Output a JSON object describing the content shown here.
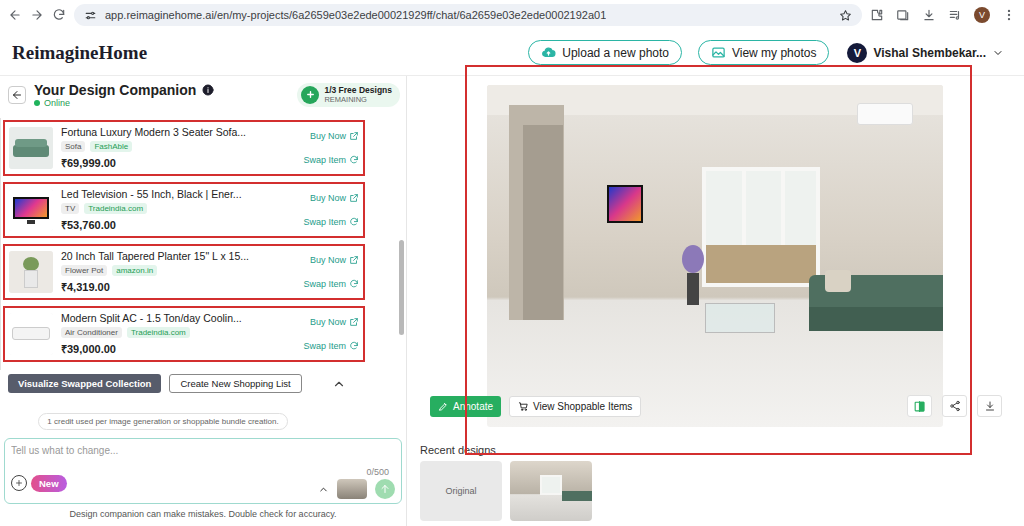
{
  "browser": {
    "url": "app.reimaginehome.ai/en/my-projects/6a2659e03e2ede00021929ff/chat/6a2659e03e2ede0002192a01",
    "avatar": "V"
  },
  "header": {
    "logo": "ReimagineHome",
    "buttons": [
      "Upload a new photo",
      "View my photos"
    ],
    "user": {
      "initial": "V",
      "name": "Vishal Shembekar..."
    }
  },
  "chat": {
    "title": "Your Design Companion",
    "status": "Online",
    "badge": {
      "count": "1/3 Free Designs",
      "label": "REMAINING"
    }
  },
  "products": [
    {
      "title": "Fortuna Luxury Modern 3 Seater Sofa...",
      "tags": [
        {
          "text": "Sofa",
          "kind": "category"
        },
        {
          "text": "FashAble",
          "kind": "store"
        }
      ],
      "price": "₹69,999.00",
      "buy": "Buy Now",
      "swap": "Swap Item",
      "highlighted": true,
      "kind": "sofa"
    },
    {
      "title": "Led Television - 55 Inch, Black | Ener...",
      "tags": [
        {
          "text": "TV",
          "kind": "category"
        },
        {
          "text": "Tradeindia.com",
          "kind": "store"
        }
      ],
      "price": "₹53,760.00",
      "buy": "Buy Now",
      "swap": "Swap Item",
      "highlighted": true,
      "kind": "tv"
    },
    {
      "title": "20 Inch Tall Tapered Planter 15\" L x 15...",
      "tags": [
        {
          "text": "Flower Pot",
          "kind": "category"
        },
        {
          "text": "amazon.in",
          "kind": "store"
        }
      ],
      "price": "₹4,319.00",
      "buy": "Buy Now",
      "swap": "Swap Item",
      "highlighted": true,
      "kind": "planter"
    },
    {
      "title": "Modern Split AC - 1.5 Ton/day Coolin...",
      "tags": [
        {
          "text": "Air Conditioner",
          "kind": "category"
        },
        {
          "text": "Tradeindia.com",
          "kind": "store"
        }
      ],
      "price": "₹39,000.00",
      "buy": "Buy Now",
      "swap": "Swap Item",
      "highlighted": true,
      "kind": "ac"
    }
  ],
  "actions": {
    "visualize": "Visualize Swapped Collection",
    "new_list": "Create New Shopping List"
  },
  "credit_note": "1 credit used per image generation or shoppable bundle creation.",
  "input": {
    "placeholder": "Tell us what to change...",
    "counter": "0/500",
    "new_button": "New"
  },
  "disclaimer": "Design companion can make mistakes. Double check for accuracy.",
  "canvas": {
    "highlighted": true,
    "annotate": "Annotate",
    "shoppable": "View Shoppable Items"
  },
  "recent": {
    "label": "Recent designs",
    "original": "Original"
  }
}
